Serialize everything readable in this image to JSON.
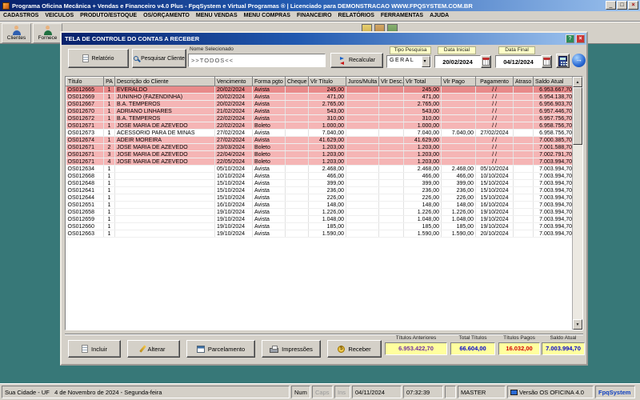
{
  "window": {
    "title": "Programa Oficina Mecânica + Vendas e Financeiro v4.0 Plus - FpqSystem e Virtual Programas ® | Licenciado para DEMONSTRACAO WWW.FPQSYSTEM.COM.BR",
    "controls": {
      "minimize": "_",
      "maximize": "□",
      "close": "×"
    }
  },
  "menu": [
    "CADASTROS",
    "VEICULOS",
    "PRODUTO/ESTOQUE",
    "OS/ORÇAMENTO",
    "MENU VENDAS",
    "MENU COMPRAS",
    "FINANCEIRO",
    "RELATÓRIOS",
    "FERRAMENTAS",
    "AJUDA"
  ],
  "toolbar_buttons": [
    {
      "label": "Clientes",
      "shirt": "#2f5fb0"
    },
    {
      "label": "Fornece",
      "shirt": "#207040"
    }
  ],
  "icons": {
    "app": "wrench-logo",
    "report": "document",
    "search": "magnifier",
    "recalculate": "swap-arrows",
    "calendar": "calendar",
    "calculator": "calculator",
    "go": "blue-arrow-circle",
    "monitor": "computer-monitor"
  },
  "dialog": {
    "title": "TELA DE CONTROLE DO CONTAS A RECEBER",
    "help_button": "?",
    "close_button": "×",
    "toolbar": {
      "report_button": "Relatório",
      "search_client_button": "Pesquisar Cliente",
      "selected_name_label": "Nome Selecionado",
      "selected_name_value": ">>TODOS<<",
      "recalculate_button": "Recalcular",
      "search_type_label": "Tipo Pesquisa",
      "search_type_value": "GERAL",
      "start_date_label": "Data Inicial",
      "start_date_value": "20/02/2024",
      "end_date_label": "Data Final",
      "end_date_value": "04/12/2024"
    },
    "table": {
      "headers": [
        "Título",
        "PA",
        "Descrição do Cliente",
        "Vencimento",
        "Forma pgto",
        "Cheque",
        "Vlr Título",
        "Juros/Multa",
        "Vlr Desc.",
        "Vlr Total",
        "Vlr Pago",
        "Pagamento",
        "Atraso",
        "Saldo Atual"
      ],
      "rows": [
        {
          "state": "selected",
          "cells": [
            "OS012665",
            "1",
            "EVERALDO",
            "20/02/2024",
            "Avista",
            "",
            "245,00",
            "",
            "",
            "245,00",
            "",
            "/ /",
            "",
            "6.953.667,70"
          ]
        },
        {
          "state": "overdue",
          "cells": [
            "OS012669",
            "1",
            "JUNINHO (FAZENDINHA)",
            "20/02/2024",
            "Avista",
            "",
            "471,00",
            "",
            "",
            "471,00",
            "",
            "/ /",
            "",
            "6.954.138,70"
          ]
        },
        {
          "state": "overdue",
          "cells": [
            "OS012667",
            "1",
            "B.A. TEMPEROS",
            "20/02/2024",
            "Avista",
            "",
            "2.765,00",
            "",
            "",
            "2.765,00",
            "",
            "/ /",
            "",
            "6.956.903,70"
          ]
        },
        {
          "state": "overdue",
          "cells": [
            "OS012670",
            "1",
            "ADRIANO LINHARES",
            "21/02/2024",
            "Avista",
            "",
            "543,00",
            "",
            "",
            "543,00",
            "",
            "/ /",
            "",
            "6.957.446,70"
          ]
        },
        {
          "state": "overdue",
          "cells": [
            "OS012672",
            "1",
            "B.A. TEMPEROS",
            "22/02/2024",
            "Avista",
            "",
            "310,00",
            "",
            "",
            "310,00",
            "",
            "/ /",
            "",
            "6.957.756,70"
          ]
        },
        {
          "state": "overdue",
          "cells": [
            "OS012671",
            "1",
            "JOSE MARIA DE AZEVEDO",
            "22/02/2024",
            "Boleto",
            "",
            "1.000,00",
            "",
            "",
            "1.000,00",
            "",
            "/ /",
            "",
            "6.958.756,70"
          ]
        },
        {
          "state": "paid",
          "cells": [
            "OS012673",
            "1",
            "ACESSORIO PARA DE MINAS",
            "27/02/2024",
            "Avista",
            "",
            "7.040,00",
            "",
            "",
            "7.040,00",
            "7.040,00",
            "27/02/2024",
            "",
            "6.958.756,70"
          ]
        },
        {
          "state": "overdue",
          "cells": [
            "OS012674",
            "1",
            "ADEIR MOREIRA",
            "27/02/2024",
            "Avista",
            "",
            "41.629,00",
            "",
            "",
            "41.629,00",
            "",
            "/ /",
            "",
            "7.000.385,70"
          ]
        },
        {
          "state": "overdue",
          "cells": [
            "OS012671",
            "2",
            "JOSE MARIA DE AZEVEDO",
            "23/03/2024",
            "Boleto",
            "",
            "1.203,00",
            "",
            "",
            "1.203,00",
            "",
            "/ /",
            "",
            "7.001.588,70"
          ]
        },
        {
          "state": "overdue",
          "cells": [
            "OS012671",
            "3",
            "JOSE MARIA DE AZEVEDO",
            "22/04/2024",
            "Boleto",
            "",
            "1.203,00",
            "",
            "",
            "1.203,00",
            "",
            "/ /",
            "",
            "7.002.791,70"
          ]
        },
        {
          "state": "overdue",
          "cells": [
            "OS012671",
            "4",
            "JOSE MARIA DE AZEVEDO",
            "22/05/2024",
            "Boleto",
            "",
            "1.203,00",
            "",
            "",
            "1.203,00",
            "",
            "/ /",
            "",
            "7.003.994,70"
          ]
        },
        {
          "state": "paid",
          "cells": [
            "OS012634",
            "1",
            "",
            "05/10/2024",
            "Avista",
            "",
            "2.468,00",
            "",
            "",
            "2.468,00",
            "2.468,00",
            "05/10/2024",
            "",
            "7.003.994,70"
          ]
        },
        {
          "state": "paid",
          "cells": [
            "OS012668",
            "1",
            "",
            "10/10/2024",
            "Avista",
            "",
            "466,00",
            "",
            "",
            "466,00",
            "466,00",
            "10/10/2024",
            "",
            "7.003.994,70"
          ]
        },
        {
          "state": "paid",
          "cells": [
            "OS012648",
            "1",
            "",
            "15/10/2024",
            "Avista",
            "",
            "399,00",
            "",
            "",
            "399,00",
            "399,00",
            "15/10/2024",
            "",
            "7.003.994,70"
          ]
        },
        {
          "state": "paid",
          "cells": [
            "OS012641",
            "1",
            "",
            "15/10/2024",
            "Avista",
            "",
            "236,00",
            "",
            "",
            "236,00",
            "236,00",
            "15/10/2024",
            "",
            "7.003.994,70"
          ]
        },
        {
          "state": "paid",
          "cells": [
            "OS012644",
            "1",
            "",
            "15/10/2024",
            "Avista",
            "",
            "226,00",
            "",
            "",
            "226,00",
            "226,00",
            "15/10/2024",
            "",
            "7.003.994,70"
          ]
        },
        {
          "state": "paid",
          "cells": [
            "OS012651",
            "1",
            "",
            "16/10/2024",
            "Avista",
            "",
            "148,00",
            "",
            "",
            "148,00",
            "148,00",
            "16/10/2024",
            "",
            "7.003.994,70"
          ]
        },
        {
          "state": "paid",
          "cells": [
            "OS012658",
            "1",
            "",
            "19/10/2024",
            "Avista",
            "",
            "1.226,00",
            "",
            "",
            "1.226,00",
            "1.226,00",
            "19/10/2024",
            "",
            "7.003.994,70"
          ]
        },
        {
          "state": "paid",
          "cells": [
            "OS012659",
            "1",
            "",
            "19/10/2024",
            "Avista",
            "",
            "1.048,00",
            "",
            "",
            "1.048,00",
            "1.048,00",
            "19/10/2024",
            "",
            "7.003.994,70"
          ]
        },
        {
          "state": "paid",
          "cells": [
            "OS012660",
            "1",
            "",
            "19/10/2024",
            "Avista",
            "",
            "185,00",
            "",
            "",
            "185,00",
            "185,00",
            "19/10/2024",
            "",
            "7.003.994,70"
          ]
        },
        {
          "state": "paid",
          "cells": [
            "OS012663",
            "1",
            "",
            "19/10/2024",
            "Avista",
            "",
            "1.590,00",
            "",
            "",
            "1.590,00",
            "1.590,00",
            "20/10/2024",
            "",
            "7.003.994,70"
          ]
        }
      ]
    },
    "footer": {
      "buttons": [
        {
          "label": "Incluir",
          "icon": "ic-doc",
          "icon_name": "new-document-icon"
        },
        {
          "label": "Alterar",
          "icon": "ic-pen",
          "icon_name": "edit-pencil-icon"
        },
        {
          "label": "Parcelamento",
          "icon": "ic-inst",
          "icon_name": "installments-icon"
        },
        {
          "label": "Impressões",
          "icon": "ic-prn",
          "icon_name": "printer-icon"
        },
        {
          "label": "Receber",
          "icon": "ic-coin",
          "icon_name": "receive-money-icon"
        }
      ],
      "totals": [
        {
          "label": "Títulos Anteriores",
          "value": "6.953.422,70",
          "color": "#7030a0"
        },
        {
          "label": "Total Títulos",
          "value": "66.604,00",
          "color": "#0000c8"
        },
        {
          "label": "Títulos Pagos",
          "value": "16.032,00",
          "color": "#d40000"
        },
        {
          "label": "Saldo Atual",
          "value": "7.003.994,70",
          "color": "#0000c8"
        }
      ]
    }
  },
  "statusbar": [
    {
      "text": "Sua Cidade - UF   4 de Novembro de 2024 - Segunda-feira",
      "state": ""
    },
    {
      "text": "Num",
      "state": ""
    },
    {
      "text": "Caps",
      "state": "dim"
    },
    {
      "text": "Ins",
      "state": "dim"
    },
    {
      "text": "04/11/2024",
      "state": ""
    },
    {
      "text": "07:32:39",
      "state": ""
    },
    {
      "text": "",
      "state": ""
    },
    {
      "text": "MASTER",
      "state": ""
    },
    {
      "text": "Versão OS OFICINA 4.0",
      "state": "monitor"
    },
    {
      "text": "FpqSystem",
      "state": "brand"
    }
  ]
}
